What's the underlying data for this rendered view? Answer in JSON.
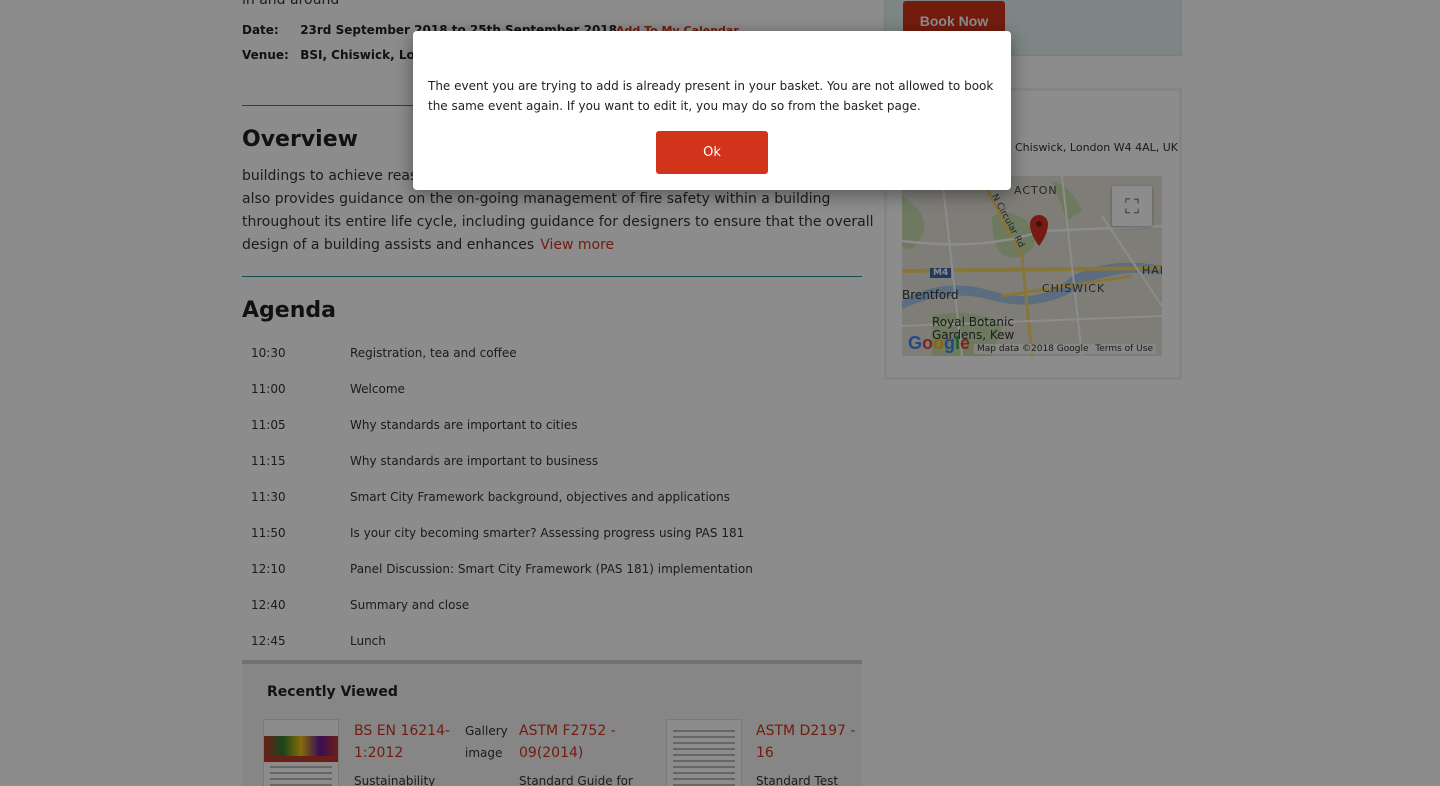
{
  "event": {
    "intro_fragment": "in and around",
    "date_label": "Date:",
    "date_value": "23rd September 2018 to 25th September 2018",
    "add_calendar": "Add To My Calendar",
    "venue_label": "Venue:",
    "venue_value": "BSI, Chiswick, London"
  },
  "overview": {
    "title": "Overview",
    "lines": [
      "buildings to achieve reasonable standards of fire safety. The document",
      "also provides guidance on the on-going management of fire safety within a building",
      "throughout its entire life cycle, including guidance for designers to ensure that the overall",
      "design of a building assists and enhances"
    ],
    "view_more": "View more"
  },
  "agenda": {
    "title": "Agenda",
    "items": [
      {
        "time": "10:30",
        "desc": "Registration, tea and coffee"
      },
      {
        "time": "11:00",
        "desc": "Welcome"
      },
      {
        "time": "11:05",
        "desc": "Why standards are important to cities"
      },
      {
        "time": "11:15",
        "desc": "Why standards are important to business"
      },
      {
        "time": "11:30",
        "desc": "Smart City Framework background, objectives and applications"
      },
      {
        "time": "11:50",
        "desc": "Is your city becoming smarter? Assessing progress using PAS 181"
      },
      {
        "time": "12:10",
        "desc": "Panel Discussion: Smart City Framework (PAS 181) implementation"
      },
      {
        "time": "12:40",
        "desc": "Summary and close"
      },
      {
        "time": "12:45",
        "desc": "Lunch"
      }
    ]
  },
  "recently_viewed": {
    "title": "Recently Viewed",
    "items": [
      {
        "link": "BS EN 16214-1:2012",
        "sub": "Sustainability"
      },
      {
        "gallery": "Gallery image",
        "link": "ASTM F2752 - 09(2014)",
        "sub": "Standard Guide for"
      },
      {
        "link": "ASTM D2197 - 16",
        "sub": "Standard Test"
      }
    ]
  },
  "sidebar": {
    "book_now": "Book Now",
    "address": "Chiswick, London W4 4AL, UK",
    "map": {
      "labels": {
        "acton": "ACTON",
        "circular": "N Circular Rd",
        "m4": "M4",
        "brentford": "Brentford",
        "chiswick": "CHISWICK",
        "ham": "HAM",
        "kew": "Royal Botanic Gardens, Kew"
      },
      "credit": "Map data ©2018 Google",
      "terms": "Terms of Use",
      "fullscreen_icon": "fullscreen-icon",
      "pin_icon": "map-pin-icon"
    }
  },
  "modal": {
    "message": "The event you are trying to add is already present in your basket. You are not allowed to book the same event again. If you want to edit it, you may do so from the basket page.",
    "ok_label": "Ok"
  },
  "colors": {
    "accent": "#d2341b",
    "rule": "#1d8a8a",
    "overlay": "rgba(0,0,0,0.45)"
  }
}
